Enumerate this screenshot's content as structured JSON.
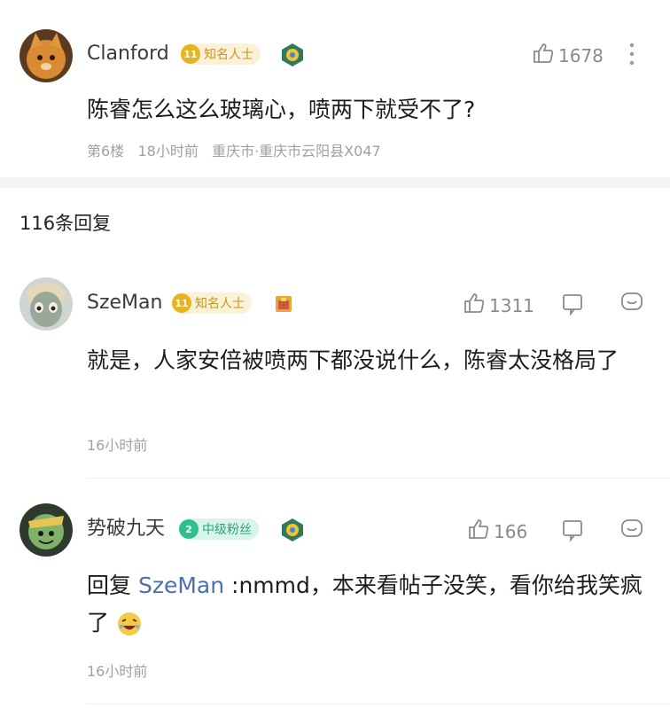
{
  "main_post": {
    "username": "Clanford",
    "badge_level": "11",
    "badge_label": "知名人士",
    "like_count": "1678",
    "content": "陈睿怎么这么玻璃心，喷两下就受不了?",
    "floor": "第6楼",
    "time": "18小时前",
    "location": "重庆市·重庆市云阳县X047"
  },
  "replies_header": {
    "count_label": "116条回复"
  },
  "replies": [
    {
      "username": "SzeMan",
      "badge_level": "11",
      "badge_label": "知名人士",
      "like_count": "1311",
      "content": "就是，人家安倍被喷两下都没说什么，陈睿太没格局了",
      "time": "16小时前"
    },
    {
      "username": "势破九天",
      "badge_level": "2",
      "badge_label": "中级粉丝",
      "like_count": "166",
      "reply_prefix": "回复",
      "reply_to": "SzeMan",
      "content": " :nmmd，本来看帖子没笑，看你给我笑疯了",
      "emoji": "laughing-face",
      "time": "16小时前"
    }
  ],
  "colors": {
    "gold_badge": "#e8b321",
    "green_badge": "#2fbf8f",
    "link": "#4c6fb2",
    "meta_gray": "#a0a0a0"
  },
  "icons": [
    "thumb-up-icon",
    "more-icon",
    "dislike-icon",
    "comment-icon",
    "decoration-icon"
  ]
}
